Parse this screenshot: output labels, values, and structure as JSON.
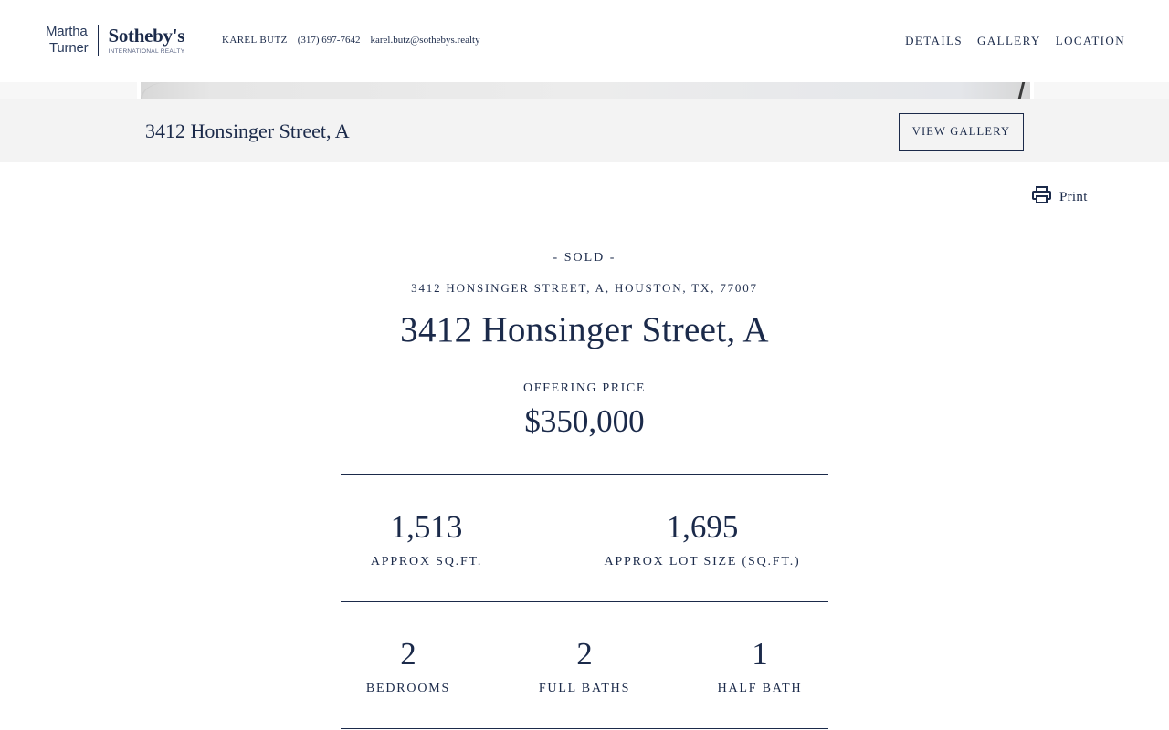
{
  "header": {
    "logo": {
      "line1": "Martha",
      "line2": "Turner",
      "brand": "Sotheby's",
      "sub": "INTERNATIONAL REALTY"
    },
    "agent": {
      "name": "KAREL BUTZ",
      "phone": "(317) 697-7642",
      "email": "karel.butz@sothebys.realty"
    },
    "nav": [
      "DETAILS",
      "GALLERY",
      "LOCATION"
    ]
  },
  "address_bar": {
    "title": "3412 Honsinger Street, A",
    "button": "VIEW GALLERY"
  },
  "print": {
    "label": "Print",
    "icon": "printer-icon"
  },
  "listing": {
    "status": "- SOLD -",
    "full_address": "3412 HONSINGER STREET, A, HOUSTON, TX, 77007",
    "title": "3412 Honsinger Street, A",
    "offering_label": "OFFERING PRICE",
    "price": "$350,000",
    "stats_row1": [
      {
        "value": "1,513",
        "caption": "APPROX SQ.FT."
      },
      {
        "value": "1,695",
        "caption": "APPROX LOT SIZE (SQ.FT.)"
      }
    ],
    "stats_row2": [
      {
        "value": "2",
        "caption": "BEDROOMS"
      },
      {
        "value": "2",
        "caption": "FULL BATHS"
      },
      {
        "value": "1",
        "caption": "HALF BATH"
      }
    ]
  },
  "colors": {
    "navy": "#1b2a4a",
    "bar_bg": "#f3f3f3"
  }
}
